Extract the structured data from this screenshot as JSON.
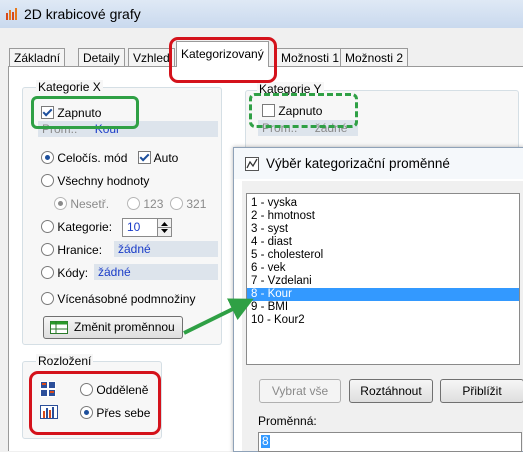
{
  "window": {
    "title": "2D krabicové grafy"
  },
  "tabs": [
    {
      "label": "Základní"
    },
    {
      "label": "Detaily"
    },
    {
      "label": "Vzhled"
    },
    {
      "label": "Kategorizovaný"
    },
    {
      "label": "Možnosti 1"
    },
    {
      "label": "Možnosti 2"
    }
  ],
  "category_x": {
    "legend": "Kategorie X",
    "enabled_label": "Zapnuto",
    "var_label": "Prom.:",
    "var_value": "Kour",
    "intmode_label": "Celočís. mód",
    "auto_label": "Auto",
    "all_values_label": "Všechny hodnoty",
    "nonstat_label": "Nesetř.",
    "opt_123": "123",
    "opt_321": "321",
    "categories_label": "Kategorie:",
    "categories_value": "10",
    "bounds_label": "Hranice:",
    "bounds_value": "žádné",
    "codes_label": "Kódy:",
    "codes_value": "žádné",
    "multisubset_label": "Vícenásobné podmnožiny",
    "change_var_button": "Změnit proměnnou"
  },
  "category_y": {
    "legend": "Kategorie Y",
    "enabled_label": "Zapnuto",
    "var_label": "Prom.:",
    "var_value": "žádné"
  },
  "layout": {
    "legend": "Rozložení",
    "separate_label": "Odděleně",
    "overlay_label": "Přes sebe"
  },
  "dialog": {
    "title": "Výběr kategorizační proměnné",
    "variables": [
      "1 - vyska",
      "2 - hmotnost",
      "3 - syst",
      "4 - diast",
      "5 - cholesterol",
      "6 - vek",
      "7 - Vzdelani",
      "8 - Kour",
      "9 - BMI",
      "10 - Kour2"
    ],
    "selected_index": 7,
    "select_all_button": "Vybrat vše",
    "stretch_button": "Roztáhnout",
    "zoom_button": "Přiblížit",
    "variable_label": "Proměnná:",
    "variable_value": "8"
  },
  "colors": {
    "annotation_red": "#d4121b",
    "annotation_green": "#2fa045",
    "selection_blue": "#3399ff",
    "link_blue": "#1a3cc8"
  }
}
